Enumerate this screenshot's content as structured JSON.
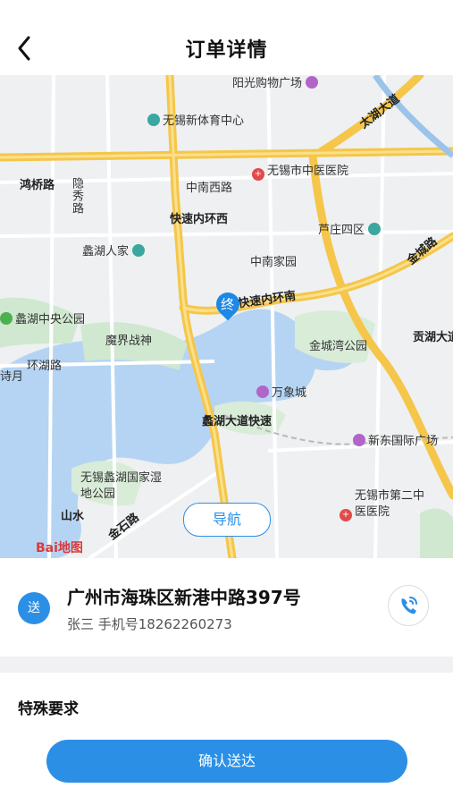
{
  "header": {
    "title": "订单详情"
  },
  "map": {
    "labels": {
      "yangguang": "阳光购物广场",
      "sports": "无锡新体育中心",
      "taihu_ave": "太湖大道",
      "hongqiao": "鸿桥路",
      "yinxiu": "隐秀路",
      "zhongnan_w": "中南西路",
      "hospital1": "无锡市中医医院",
      "luzhuang": "芦庄四区",
      "lihu_home": "蠡湖人家",
      "zhongnan_home": "中南家园",
      "jincheng_rd": "金城路",
      "inner_ring_w": "快速内环西",
      "inner_ring_s": "快速内环南",
      "lihu_park": "蠡湖中央公园",
      "mojie": "魔界战神",
      "jinchengwan": "金城湾公园",
      "gongxu": "贡湖大道",
      "huanhu": "环湖路",
      "wanxiang": "万象城",
      "lihu_ave": "蠡湖大道快速",
      "xindong": "新东国际广场",
      "wetland": "无锡蠡湖国家湿地公园",
      "hospital2": "无锡市第二中医医院",
      "jinshi": "金石路",
      "shanshui": "山水",
      "shiyue": "诗月",
      "baidu": "Bai地图"
    },
    "end_marker": "终",
    "nav_button": "导航"
  },
  "address": {
    "badge": "送",
    "title": "广州市海珠区新港中路397号",
    "contact": "张三 手机号18262260273"
  },
  "special": {
    "label": "特殊要求"
  },
  "confirm": {
    "label": "确认送达"
  },
  "colors": {
    "accent": "#2b8fe6",
    "road": "#f5c64a",
    "water": "#b5d4f4",
    "green": "#cfe8cf"
  }
}
